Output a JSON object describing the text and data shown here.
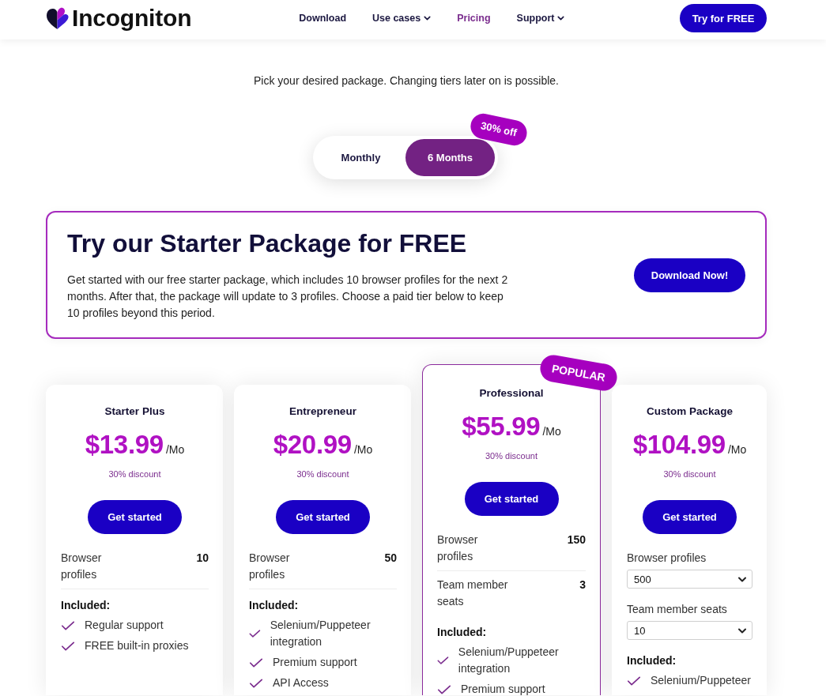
{
  "header": {
    "brand": "Incogniton",
    "nav": [
      {
        "label": "Download",
        "selected": false,
        "dropdown": false
      },
      {
        "label": "Use cases",
        "selected": false,
        "dropdown": true
      },
      {
        "label": "Pricing",
        "selected": true,
        "dropdown": false
      },
      {
        "label": "Support",
        "selected": false,
        "dropdown": true
      }
    ],
    "cta": "Try for FREE"
  },
  "intro": "Pick your desired package. Changing tiers later on is possible.",
  "billing": {
    "options": [
      {
        "label": "Monthly",
        "selected": false
      },
      {
        "label": "6 Months",
        "selected": true
      }
    ],
    "badge": "30% off"
  },
  "starter": {
    "title": "Try our Starter Package for FREE",
    "text": "Get started with our free starter package, which includes 10 browser profiles for the next 2 months. After that, the package will update to 3 profiles. Choose a paid tier below to keep 10 profiles beyond this period.",
    "button": "Download Now!"
  },
  "plans": [
    {
      "name": "Starter Plus",
      "highlighted": false,
      "price": "$13.99",
      "period": "/Mo",
      "discount": "30% discount",
      "button": "Get started",
      "specs": [
        {
          "kind": "value",
          "label": "Browser profiles",
          "value": "10"
        }
      ],
      "included_label": "Included:",
      "included": [
        "Regular support",
        "FREE built-in proxies"
      ]
    },
    {
      "name": "Entrepreneur",
      "highlighted": false,
      "price": "$20.99",
      "period": "/Mo",
      "discount": "30% discount",
      "button": "Get started",
      "specs": [
        {
          "kind": "value",
          "label": "Browser profiles",
          "value": "50"
        }
      ],
      "included_label": "Included:",
      "included": [
        "Selenium/Puppeteer integration",
        "Premium support",
        "API Access"
      ]
    },
    {
      "name": "Professional",
      "highlighted": true,
      "badge": "POPULAR",
      "price": "$55.99",
      "period": "/Mo",
      "discount": "30% discount",
      "button": "Get started",
      "specs": [
        {
          "kind": "value",
          "label": "Browser profiles",
          "value": "150"
        },
        {
          "kind": "value",
          "label": "Team member seats",
          "value": "3"
        }
      ],
      "included_label": "Included:",
      "included": [
        "Selenium/Puppeteer integration",
        "Premium support"
      ]
    },
    {
      "name": "Custom Package",
      "highlighted": false,
      "price": "$104.99",
      "period": "/Mo",
      "discount": "30% discount",
      "button": "Get started",
      "specs": [
        {
          "kind": "select",
          "label": "Browser profiles",
          "value": "500"
        },
        {
          "kind": "select",
          "label": "Team member seats",
          "value": "10"
        }
      ],
      "included_label": "Included:",
      "included": [
        "Selenium/Puppeteer"
      ]
    }
  ]
}
